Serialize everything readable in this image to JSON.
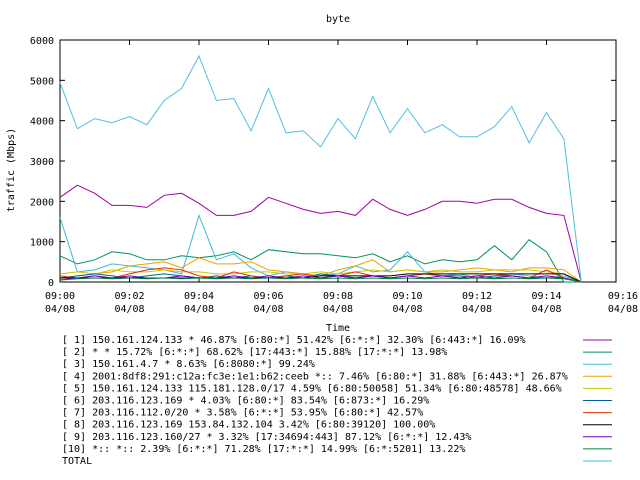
{
  "chart_data": {
    "type": "line",
    "title": "byte",
    "xlabel": "Time",
    "ylabel": "traffic (Mbps)",
    "ylim": [
      0,
      6000
    ],
    "yticks": [
      0,
      1000,
      2000,
      3000,
      4000,
      5000,
      6000
    ],
    "xlim": [
      "09:00",
      "09:16"
    ],
    "xticks": [
      {
        "time": "09:00",
        "date": "04/08"
      },
      {
        "time": "09:02",
        "date": "04/08"
      },
      {
        "time": "09:04",
        "date": "04/08"
      },
      {
        "time": "09:06",
        "date": "04/08"
      },
      {
        "time": "09:08",
        "date": "04/08"
      },
      {
        "time": "09:10",
        "date": "04/08"
      },
      {
        "time": "09:12",
        "date": "04/08"
      },
      {
        "time": "09:14",
        "date": "04/08"
      },
      {
        "time": "09:16",
        "date": "04/08"
      }
    ],
    "grid": false,
    "legend_position": "bottom",
    "x_minutes": [
      0,
      0.5,
      1,
      1.5,
      2,
      2.5,
      3,
      3.5,
      4,
      4.5,
      5,
      5.5,
      6,
      6.5,
      7,
      7.5,
      8,
      8.5,
      9,
      9.5,
      10,
      10.5,
      11,
      11.5,
      12,
      12.5,
      13,
      13.5,
      14,
      14.5,
      15
    ],
    "series": [
      {
        "name": "[ 1] 150.161.124.133 * 46.87%  [6:80:*] 51.42% [6:*:*] 32.30% [6:443:*] 16.09%",
        "color": "#a000a0",
        "values": [
          2100,
          2400,
          2200,
          1900,
          1900,
          1850,
          2150,
          2200,
          1950,
          1650,
          1650,
          1750,
          2100,
          1950,
          1800,
          1700,
          1750,
          1650,
          2050,
          1800,
          1650,
          1800,
          2000,
          2000,
          1950,
          2050,
          2050,
          1850,
          1700,
          1650,
          0
        ]
      },
      {
        "name": "[ 2] * * 15.72%  [6:*:*] 68.62% [17:443:*] 15.88% [17:*:*] 13.98%",
        "color": "#009060",
        "values": [
          650,
          450,
          550,
          750,
          700,
          550,
          550,
          650,
          600,
          650,
          750,
          550,
          800,
          750,
          700,
          700,
          650,
          600,
          700,
          500,
          650,
          450,
          550,
          500,
          550,
          900,
          550,
          1050,
          750,
          0,
          0
        ]
      },
      {
        "name": "[ 3] 150.161.4.7 * 8.63%  [6:8080:*] 99.24%",
        "color": "#40b8d8",
        "values": [
          1600,
          250,
          300,
          450,
          400,
          350,
          300,
          200,
          1650,
          550,
          700,
          350,
          150,
          250,
          200,
          150,
          200,
          400,
          250,
          300,
          750,
          250,
          150,
          200,
          100,
          150,
          200,
          150,
          100,
          150,
          0
        ]
      },
      {
        "name": "[ 4] 2001:8df8:291:c12a:fc3e:1e1:b62:ceeb *:: 7.46%  [6:80:*] 31.88% [6:443:*] 26.87%",
        "color": "#f0a000",
        "values": [
          100,
          150,
          200,
          250,
          400,
          450,
          500,
          350,
          600,
          450,
          450,
          500,
          300,
          250,
          200,
          150,
          300,
          400,
          550,
          250,
          300,
          250,
          250,
          300,
          350,
          300,
          250,
          350,
          350,
          300,
          0
        ]
      },
      {
        "name": "[ 5] 150.161.124.133 115.181.128.0/17 4.59%  [6:80:50058] 51.34% [6:80:48578] 48.66%",
        "color": "#c8c800",
        "values": [
          200,
          250,
          200,
          300,
          250,
          250,
          300,
          250,
          250,
          200,
          200,
          250,
          250,
          200,
          200,
          250,
          200,
          250,
          300,
          250,
          300,
          250,
          300,
          250,
          250,
          300,
          300,
          300,
          250,
          200,
          0
        ]
      },
      {
        "name": "[ 6] 203.116.123.169 * 4.03%  [6:80:*] 83.54% [6:873:*] 16.29%",
        "color": "#0060a0",
        "values": [
          100,
          150,
          200,
          150,
          100,
          150,
          200,
          150,
          100,
          150,
          100,
          150,
          100,
          150,
          100,
          200,
          150,
          100,
          150,
          100,
          150,
          200,
          150,
          150,
          100,
          150,
          150,
          100,
          100,
          100,
          0
        ]
      },
      {
        "name": "[ 7] 203.116.112.0/20 * 3.58%  [6:*:*] 53.95% [6:80:*] 42.57%",
        "color": "#e03000",
        "values": [
          150,
          100,
          150,
          100,
          200,
          300,
          350,
          300,
          150,
          100,
          250,
          150,
          100,
          150,
          200,
          100,
          150,
          250,
          150,
          100,
          150,
          200,
          150,
          100,
          150,
          200,
          150,
          100,
          300,
          100,
          0
        ]
      },
      {
        "name": "[ 8] 203.116.123.169 153.84.132.104 3.42%  [6:80:39120] 100.00%",
        "color": "#000000",
        "values": [
          100,
          100,
          100,
          100,
          100,
          100,
          100,
          100,
          100,
          100,
          100,
          100,
          100,
          100,
          100,
          150,
          150,
          150,
          150,
          150,
          200,
          200,
          200,
          200,
          200,
          200,
          200,
          200,
          200,
          200,
          0
        ]
      },
      {
        "name": "[ 9] 203.116.123.160/27 * 3.32%  [17:34694:443] 87.12% [6:*:*] 12.43%",
        "color": "#7000c0",
        "values": [
          50,
          100,
          150,
          100,
          150,
          100,
          100,
          150,
          100,
          100,
          150,
          100,
          150,
          100,
          150,
          100,
          150,
          100,
          150,
          100,
          150,
          100,
          150,
          100,
          150,
          100,
          150,
          100,
          150,
          100,
          0
        ]
      },
      {
        "name": "[10] *:: *:: 2.39%  [6:*:*] 71.28% [17:*:*] 14.99% [6:*:5201] 13.22%",
        "color": "#008040",
        "values": [
          50,
          80,
          100,
          80,
          100,
          80,
          100,
          80,
          100,
          80,
          100,
          80,
          100,
          80,
          100,
          80,
          100,
          80,
          100,
          80,
          100,
          80,
          100,
          80,
          100,
          80,
          100,
          80,
          100,
          80,
          0
        ]
      },
      {
        "name": "TOTAL",
        "color": "#50c0e0",
        "values": [
          4950,
          3800,
          4050,
          3950,
          4100,
          3900,
          4500,
          4800,
          5600,
          4500,
          4550,
          3750,
          4800,
          3700,
          3750,
          3350,
          4050,
          3550,
          4600,
          3700,
          4300,
          3700,
          3900,
          3600,
          3600,
          3850,
          4350,
          3450,
          4200,
          3550,
          0
        ]
      }
    ]
  }
}
